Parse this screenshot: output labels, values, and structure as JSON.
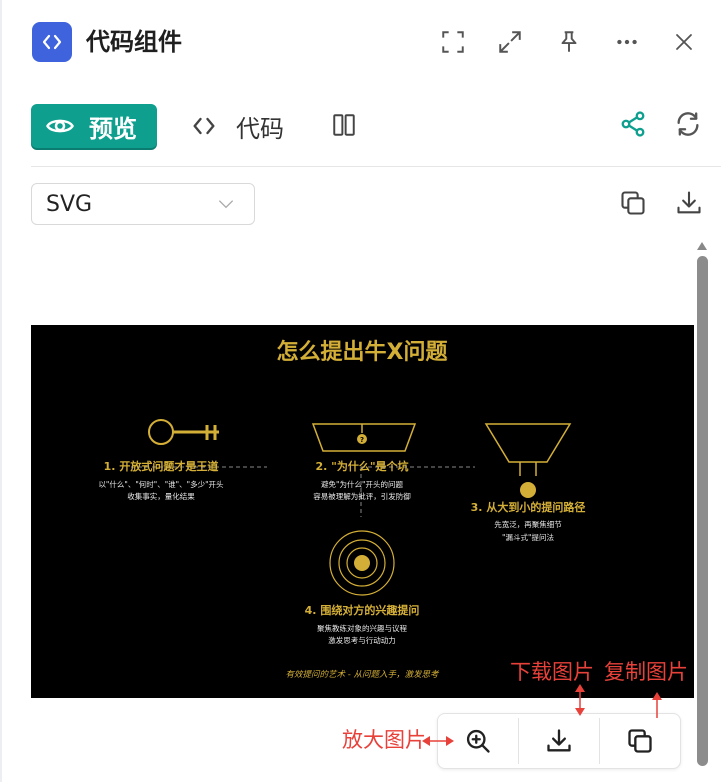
{
  "header": {
    "title": "代码组件",
    "app_icon": "code-brackets-icon",
    "buttons": [
      "focus-frame-icon",
      "expand-icon",
      "pin-icon",
      "more-icon",
      "close-icon"
    ]
  },
  "tabs": {
    "preview_label": "预览",
    "code_label": "代码",
    "active": "preview"
  },
  "toolbar": {
    "format_value": "SVG",
    "copy_icon": "copy-icon",
    "download_icon": "download-icon"
  },
  "preview": {
    "title": "怎么提出牛X问题",
    "step1_title": "1. 开放式问题才是王道",
    "step1_line1": "以\"什么\"、\"何时\"、\"谁\"、\"多少\"开头",
    "step1_line2": "收集事实，量化结果",
    "step2_title": "2. \"为什么\"是个坑",
    "step2_line1": "避免\"为什么\"开头的问题",
    "step2_line2": "容易被理解为批评，引发防御",
    "step3_title": "3. 从大到小的提问路径",
    "step3_line1": "先宽泛，再聚焦细节",
    "step3_line2": "\"漏斗式\"提问法",
    "step4_title": "4. 围绕对方的兴趣提问",
    "step4_line1": "聚焦教练对象的兴趣与议程",
    "step4_line2": "激发思考与行动动力",
    "footer": "有效提问的艺术 - 从问题入手，激发思考",
    "question_mark": "?"
  },
  "image_toolbar": {
    "buttons": [
      "zoom-in-icon",
      "download-icon",
      "copy-icon"
    ]
  },
  "annotations": {
    "zoom": "放大图片",
    "download": "下载图片",
    "copy": "复制图片"
  },
  "colors": {
    "accent": "#0e9f8e",
    "brand_blue": "#3e63dd",
    "gold": "#d4af37",
    "annotation_red": "#e8413a"
  }
}
